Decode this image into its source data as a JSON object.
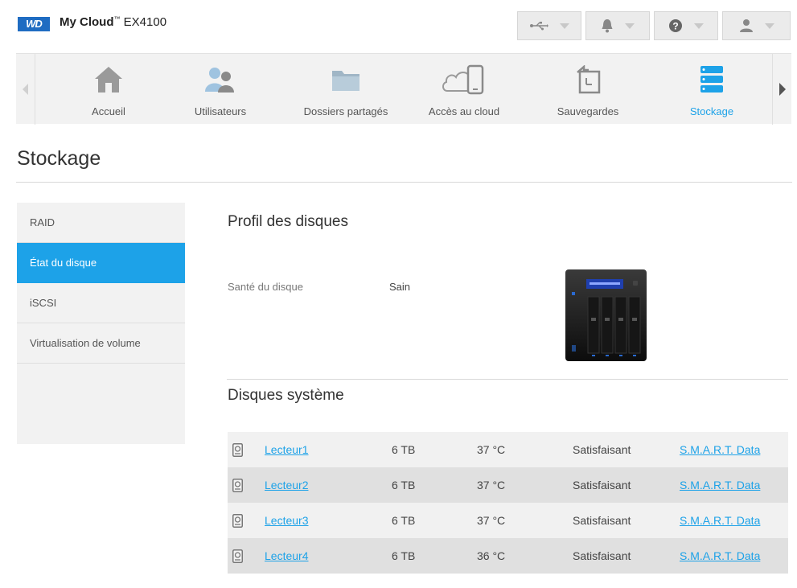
{
  "header": {
    "logo_text": "WD",
    "brand": "My Cloud",
    "trademark": "™",
    "model": "EX4100"
  },
  "nav": {
    "items": [
      {
        "label": "Accueil",
        "icon": "home-icon"
      },
      {
        "label": "Utilisateurs",
        "icon": "users-icon"
      },
      {
        "label": "Dossiers partagés",
        "icon": "folder-icon"
      },
      {
        "label": "Accès au cloud",
        "icon": "cloud-device-icon"
      },
      {
        "label": "Sauvegardes",
        "icon": "backup-icon"
      },
      {
        "label": "Stockage",
        "icon": "storage-icon"
      }
    ],
    "active": "Stockage"
  },
  "page": {
    "title": "Stockage"
  },
  "sidebar": {
    "items": [
      {
        "label": "RAID"
      },
      {
        "label": "État du disque"
      },
      {
        "label": "iSCSI"
      },
      {
        "label": "Virtualisation de volume"
      }
    ],
    "active": "État du disque"
  },
  "profile": {
    "title": "Profil des disques",
    "health_label": "Santé du disque",
    "health_value": "Sain"
  },
  "system_disks": {
    "title": "Disques système",
    "rows": [
      {
        "name": "Lecteur1",
        "size": "6 TB",
        "temp": "37 °C",
        "status": "Satisfaisant",
        "smart": "S.M.A.R.T. Data"
      },
      {
        "name": "Lecteur2",
        "size": "6 TB",
        "temp": "37 °C",
        "status": "Satisfaisant",
        "smart": "S.M.A.R.T. Data"
      },
      {
        "name": "Lecteur3",
        "size": "6 TB",
        "temp": "37 °C",
        "status": "Satisfaisant",
        "smart": "S.M.A.R.T. Data"
      },
      {
        "name": "Lecteur4",
        "size": "6 TB",
        "temp": "36 °C",
        "status": "Satisfaisant",
        "smart": "S.M.A.R.T. Data"
      }
    ]
  },
  "colors": {
    "accent": "#1da2e8",
    "logo": "#1f6cc2",
    "panel": "#f2f2f2"
  }
}
